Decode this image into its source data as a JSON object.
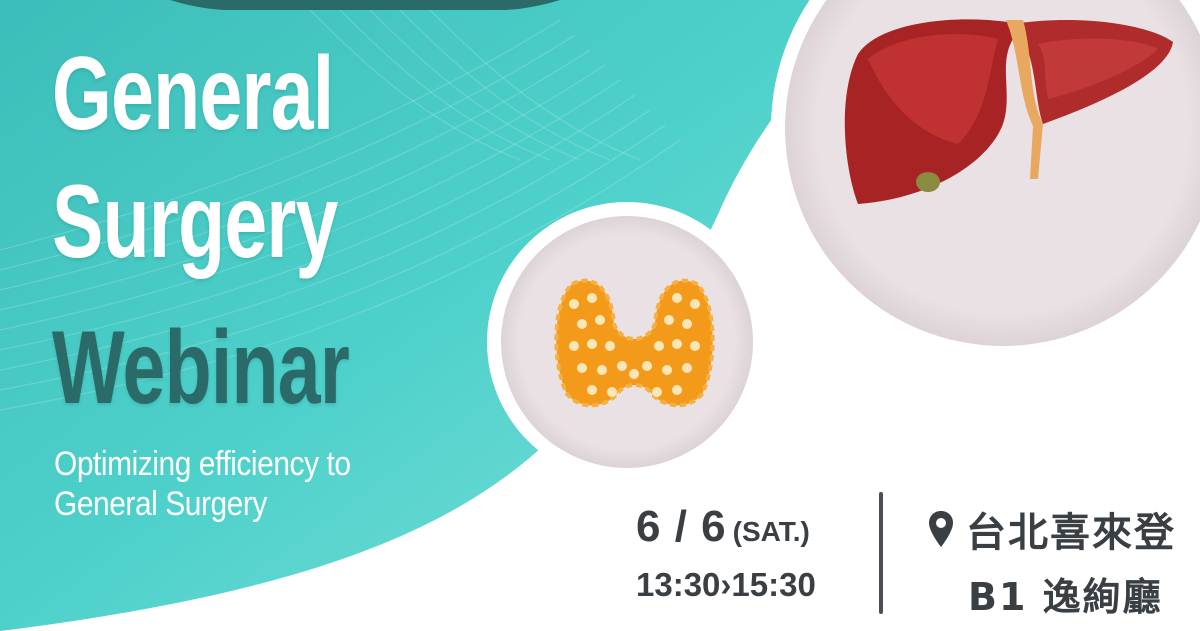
{
  "title": {
    "line1": "General",
    "line2": "Surgery",
    "line3": "Webinar"
  },
  "subtitle": {
    "line1": "Optimizing efficiency to",
    "line2": "General Surgery"
  },
  "event": {
    "date": "6 / 6",
    "weekday": "(SAT.)",
    "time": "13:30›15:30"
  },
  "venue": {
    "icon": "location-pin-icon",
    "name": "台北喜來登",
    "room": "B1  逸絢廳"
  },
  "colors": {
    "teal": "#45c9c4",
    "dark_teal": "#2a6a68",
    "text_dark": "#3a3f44",
    "circle_fill": "#e9e1e3",
    "liver": "#b52a2a",
    "thyroid": "#f49a1a"
  },
  "illustrations": [
    "liver-illustration",
    "thyroid-illustration"
  ]
}
